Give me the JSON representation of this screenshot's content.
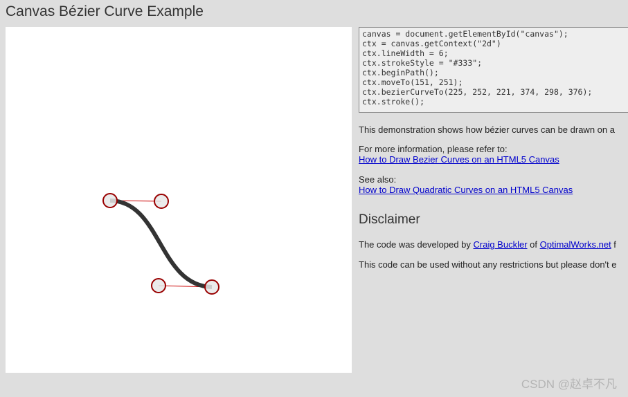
{
  "page": {
    "title": "Canvas Bézier Curve Example"
  },
  "code": {
    "lines": [
      "canvas = document.getElementById(\"canvas\");",
      "ctx = canvas.getContext(\"2d\")",
      "ctx.lineWidth = 6;",
      "ctx.strokeStyle = \"#333\";",
      "ctx.beginPath();",
      "ctx.moveTo(151, 251);",
      "ctx.bezierCurveTo(225, 252, 221, 374, 298, 376);",
      "ctx.stroke();"
    ]
  },
  "curve": {
    "start": [
      151,
      251
    ],
    "cp1": [
      225,
      252
    ],
    "cp2": [
      221,
      374
    ],
    "end": [
      298,
      376
    ],
    "line_width": 6,
    "stroke_color": "#333333",
    "handle_color": "#cc0000",
    "point_fill": "#e8e8e8",
    "point_stroke": "#990000"
  },
  "info": {
    "demo_text": "This demonstration shows how bézier curves can be drawn on a",
    "more_info_text": "For more information, please refer to:",
    "more_info_link": "How to Draw Bezier Curves on an HTML5 Canvas",
    "see_also_text": "See also:",
    "see_also_link": "How to Draw Quadratic Curves on an HTML5 Canvas",
    "disclaimer_heading": "Disclaimer",
    "dev_prefix": "The code was developed by ",
    "dev_author_link": "Craig Buckler",
    "dev_of": " of ",
    "dev_site_link": "OptimalWorks.net",
    "dev_suffix": " f",
    "usage_text": "This code can be used without any restrictions but please don't e"
  },
  "watermark": {
    "text": "CSDN @赵卓不凡"
  }
}
